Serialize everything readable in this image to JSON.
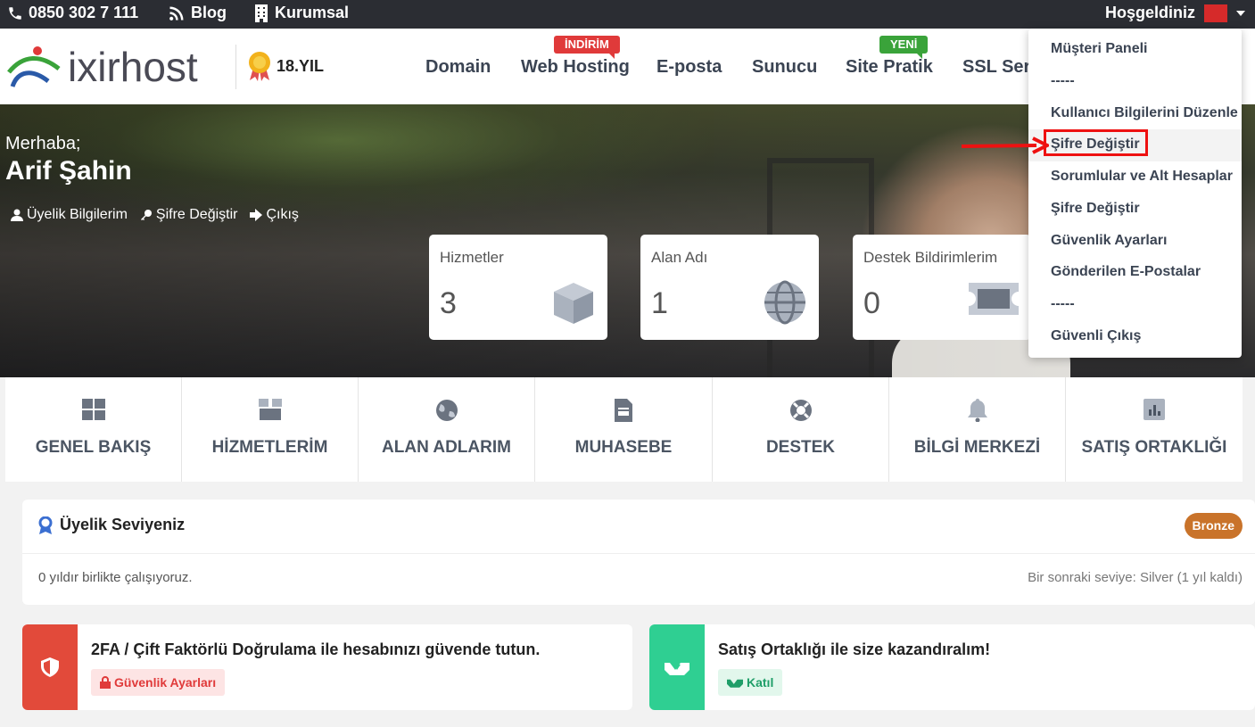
{
  "topbar": {
    "phone": "0850 302 7 111",
    "blog": "Blog",
    "corporate": "Kurumsal",
    "welcome": "Hoşgeldiniz"
  },
  "header": {
    "logo_text": "ixirhost",
    "year_badge": "18.YIL",
    "nav": [
      "Domain",
      "Web Hosting",
      "E-posta",
      "Sunucu",
      "Site Pratik",
      "SSL Sert"
    ],
    "tags": {
      "web_hosting": "İNDİRİM",
      "site_pratik": "YENİ"
    }
  },
  "user_menu": {
    "items": [
      "Müşteri Paneli",
      "-----",
      "Kullanıcı Bilgilerini Düzenle",
      "Şifre Değiştir",
      "Sorumlular ve Alt Hesaplar",
      "Şifre Değiştir",
      "Güvenlik Ayarları",
      "Gönderilen E-Postalar",
      "-----",
      "Güvenli Çıkış"
    ]
  },
  "hero": {
    "greeting": "Merhaba;",
    "name": "Arif Şahin",
    "links": {
      "profile": "Üyelik Bilgilerim",
      "password": "Şifre Değiştir",
      "logout": "Çıkış"
    }
  },
  "stats": [
    {
      "title": "Hizmetler",
      "value": "3",
      "icon": "box-icon"
    },
    {
      "title": "Alan Adı",
      "value": "1",
      "icon": "globe-icon"
    },
    {
      "title": "Destek Bildirimlerim",
      "value": "0",
      "icon": "ticket-icon"
    }
  ],
  "main_menu": [
    "GENEL BAKIŞ",
    "HİZMETLERİM",
    "ALAN ADLARIM",
    "MUHASEBE",
    "DESTEK",
    "BİLGİ MERKEZİ",
    "SATIŞ ORTAKLIĞI"
  ],
  "membership": {
    "title": "Üyelik Seviyeniz",
    "level": "Bronze",
    "years_text": "0 yıldır birlikte çalışıyoruz.",
    "next_level": "Bir sonraki seviye: Silver (1 yıl kaldı)"
  },
  "promos": {
    "twofa": {
      "text": "2FA / Çift Faktörlü Doğrulama ile hesabınızı güvende tutun.",
      "button": "Güvenlik Ayarları"
    },
    "affiliate": {
      "text": "Satış Ortaklığı ile size kazandıralım!",
      "button": "Katıl"
    }
  },
  "colors": {
    "topbar": "#2b2d33",
    "accent_red": "#e03a3a",
    "accent_green": "#2ecc8f",
    "bronze": "#c9732a",
    "new_tag": "#3aa33a"
  }
}
